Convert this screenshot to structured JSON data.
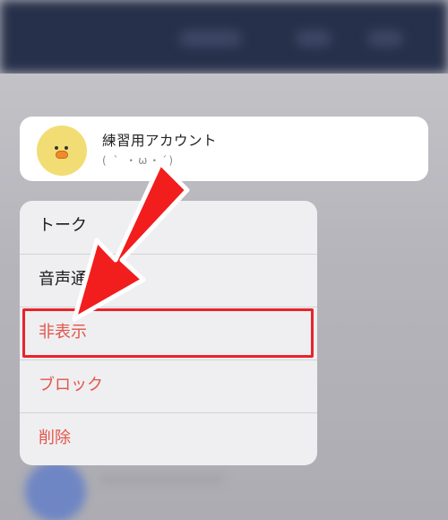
{
  "contact": {
    "name": "練習用アカウント",
    "status_message": "( ` ・ω・´)"
  },
  "menu": {
    "items": [
      {
        "label": "トーク",
        "style": "normal"
      },
      {
        "label": "音声通話",
        "style": "normal"
      },
      {
        "label": "非表示",
        "style": "destructive"
      },
      {
        "label": "ブロック",
        "style": "destructive"
      },
      {
        "label": "削除",
        "style": "destructive"
      }
    ]
  },
  "colors": {
    "destructive_text": "#e3554a",
    "annotation_red": "#e8232a",
    "avatar_yellow": "#f2dd74",
    "header_navy": "#27304a"
  },
  "icons": {
    "avatar": "duck-character-icon",
    "annotation": "red-arrow-icon"
  }
}
